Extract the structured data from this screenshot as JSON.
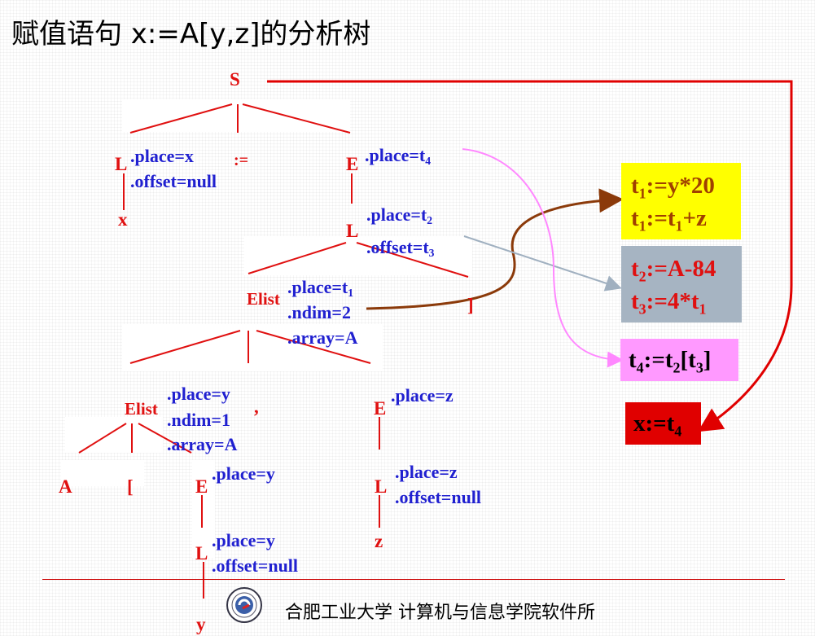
{
  "title": "赋值语句 x:=A[y,z]的分析树",
  "nodes": {
    "S": "S",
    "L_root": "L",
    "assign": ":=",
    "E_root": "E",
    "x": "x",
    "L_array": "L",
    "elist_outer": "Elist",
    "rbracket": "]",
    "elist_inner": "Elist",
    "comma": ",",
    "E_z": "E",
    "A": "A",
    "lbracket": "[",
    "E_y": "E",
    "L_z": "L",
    "L_y": "L",
    "z": "z",
    "y": "y"
  },
  "attrs": {
    "L_root_place": ".place=x",
    "L_root_offset": ".offset=null",
    "E_root_place": ".place=t",
    "E_root_place_sub": "4",
    "L_array_place": ".place=t",
    "L_array_place_sub": "2",
    "L_array_offset": ".offset=t",
    "L_array_offset_sub": "3",
    "elist_outer_place": ".place=t",
    "elist_outer_place_sub": "1",
    "elist_outer_ndim": ".ndim=2",
    "elist_outer_array": ".array=A",
    "elist_inner_place": ".place=y",
    "elist_inner_ndim": ".ndim=1",
    "elist_inner_array": ".array=A",
    "E_z_place": ".place=z",
    "E_y_place": ".place=y",
    "L_z_place": ".place=z",
    "L_z_offset": ".offset=null",
    "L_y_place": ".place=y",
    "L_y_offset": ".offset=null"
  },
  "code_boxes": [
    {
      "lines": [
        [
          "t",
          "1",
          ":=y*20"
        ],
        [
          "t",
          "1",
          ":=t",
          "1",
          "+z"
        ]
      ],
      "bg": "#ffff00",
      "color": "#a04000"
    },
    {
      "lines": [
        [
          "t",
          "2",
          ":=A-84"
        ],
        [
          "t",
          "3",
          ":=4*t",
          "1"
        ]
      ],
      "bg": "#a6b4c2",
      "color": "#e01010"
    },
    {
      "lines": [
        [
          "t",
          "4",
          ":=t",
          "2",
          "[t",
          "3",
          "]"
        ]
      ],
      "bg": "#ff99ff",
      "color": "#000000"
    },
    {
      "lines": [
        [
          "x:=t",
          "4"
        ]
      ],
      "bg": "#e00000",
      "color": "#000000"
    }
  ],
  "colors": {
    "node_red": "#e01010",
    "attr_blue": "#2020d0",
    "edge_red": "#e01010",
    "arrow_brown": "#8b3a0a",
    "arrow_gray": "#a0b0c0",
    "arrow_pink": "#ff88ff",
    "arrow_red": "#e00000"
  },
  "footer": "合肥工业大学 计算机与信息学院软件所"
}
